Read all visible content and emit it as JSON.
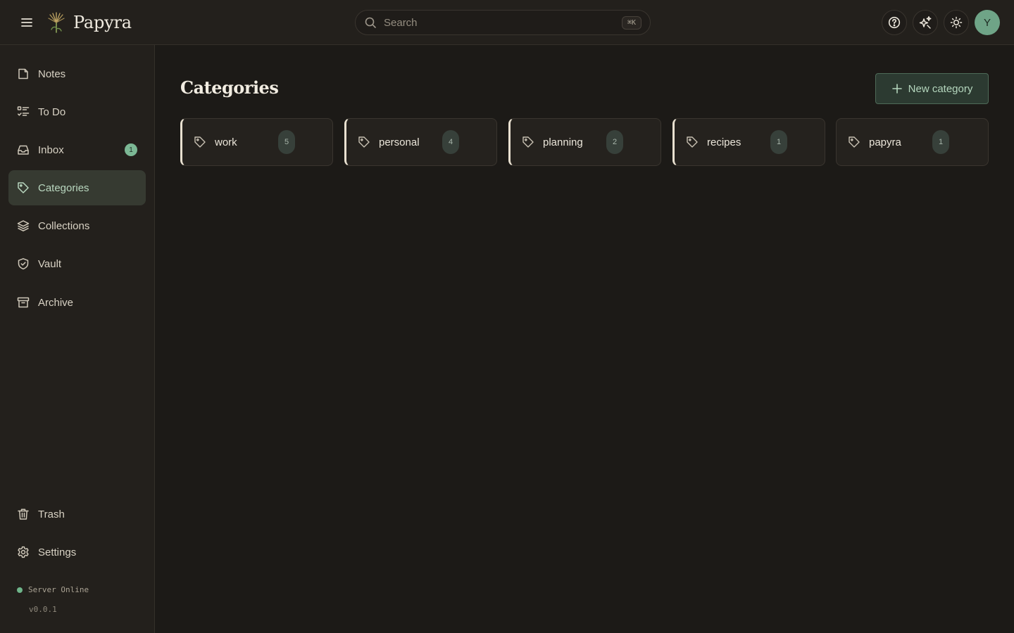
{
  "header": {
    "brand_name": "Papyra",
    "search": {
      "placeholder": "Search",
      "shortcut": "⌘K"
    },
    "avatar_initial": "Y",
    "icons": [
      "menu-icon",
      "help-icon",
      "sparkles-icon",
      "sun-icon"
    ]
  },
  "sidebar": {
    "items": [
      {
        "label": "Notes",
        "icon": "note-icon"
      },
      {
        "label": "To Do",
        "icon": "checklist-icon"
      },
      {
        "label": "Inbox",
        "icon": "inbox-icon",
        "badge": "1"
      },
      {
        "label": "Categories",
        "icon": "tag-icon",
        "active": true
      },
      {
        "label": "Collections",
        "icon": "layers-icon"
      },
      {
        "label": "Vault",
        "icon": "shield-icon"
      },
      {
        "label": "Archive",
        "icon": "archive-icon"
      }
    ],
    "bottom_items": [
      {
        "label": "Trash",
        "icon": "trash-icon"
      },
      {
        "label": "Settings",
        "icon": "gear-icon"
      }
    ],
    "status": "Server Online",
    "version": "v0.0.1"
  },
  "main": {
    "title": "Categories",
    "new_button_label": "New category",
    "categories": [
      {
        "name": "work",
        "count": "5"
      },
      {
        "name": "personal",
        "count": "4"
      },
      {
        "name": "planning",
        "count": "2"
      },
      {
        "name": "recipes",
        "count": "1"
      },
      {
        "name": "papyra",
        "count": "1"
      }
    ]
  },
  "colors": {
    "background": "#1c1a17",
    "panel": "#23201c",
    "accent": "#7cb895",
    "active_nav": "#363a31"
  }
}
